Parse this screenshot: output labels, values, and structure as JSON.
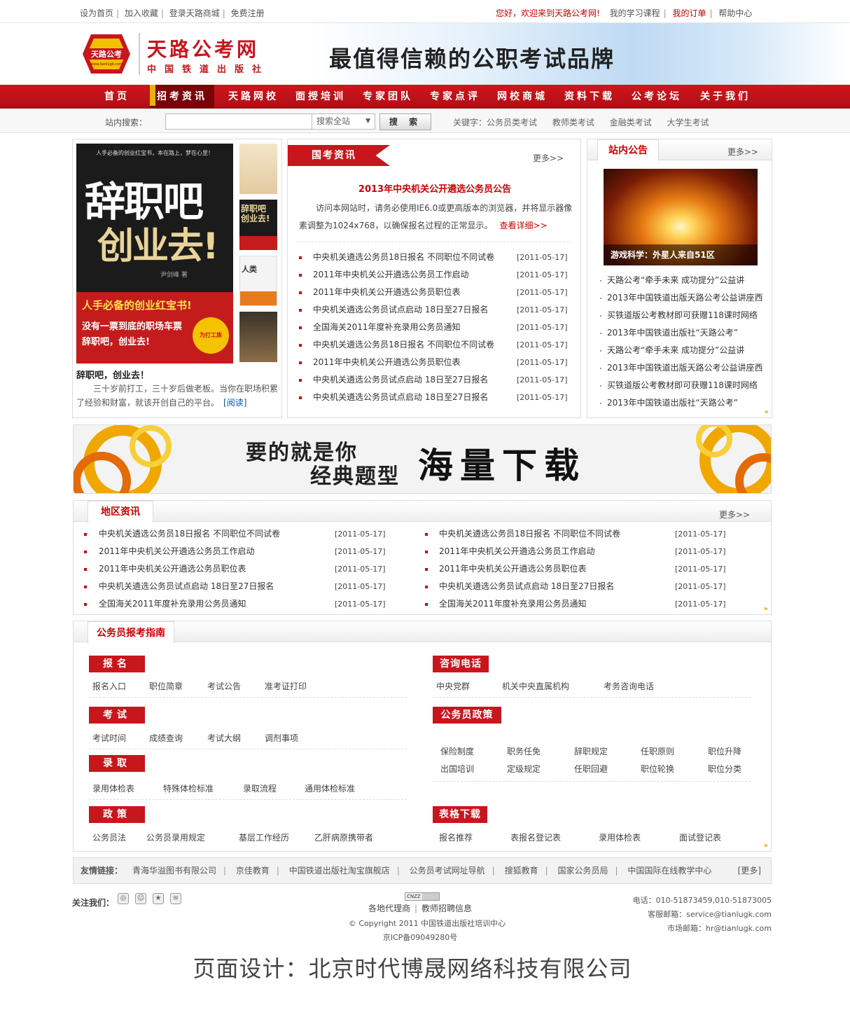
{
  "topbar": {
    "left_links": [
      "设为首页",
      "加入收藏",
      "登录天路商城",
      "免费注册"
    ],
    "welcome": "您好，欢迎来到天路公考网!",
    "right_links": [
      "我的学习课程",
      "我的订单",
      "帮助中心"
    ]
  },
  "header": {
    "logo_badge": "天路公考",
    "logo_badge_url": "www.tianlugk.com",
    "logo_title": "天路公考网",
    "logo_subtitle": "中国铁道出版社",
    "slogan": "最值得信赖的公职考试品牌"
  },
  "nav": {
    "items": [
      "首页",
      "招考资讯",
      "天路网校",
      "面授培训",
      "专家团队",
      "专家点评",
      "网校商城",
      "资料下载",
      "公考论坛",
      "关于我们"
    ],
    "active_index": 1
  },
  "search": {
    "label": "站内搜索：",
    "value": "",
    "scope": "搜索全站",
    "button": "搜 索",
    "keywords_label": "关键字：",
    "keywords": [
      "公务员类考试",
      "教师类考试",
      "金融类考试",
      "大学生考试"
    ]
  },
  "book": {
    "cover_tagline": "人手必备的创业红宝书，本在路上，梦在心里！",
    "cover_title_1": "辞职吧",
    "cover_title_2": "创业去!",
    "cover_author": "尹剑峰 著",
    "cover_red_1": "人手必备的创业红宝书!",
    "cover_red_2": "没有一票到底的职场车票",
    "cover_red_3": "辞职吧，创业去!",
    "cover_badge": "为打工族",
    "thumb_title": "辞职吧 创业去!",
    "thumb_title_2": "人类",
    "title": "辞职吧，创业去！",
    "desc": "三十岁前打工，三十岁后做老板。当你在职场积累了经验和财富，就该开创自己的平台。",
    "read": "[阅读]"
  },
  "exam_news": {
    "tab": "国考资讯",
    "more": "更多>>",
    "headline": "2013年中央机关公开遴选公务员公告",
    "summary": "访问本网站时，请务必使用IE6.0或更高版本的浏览器，并将显示器像素调整为1024x768，以确保报名过程的正常显示。",
    "detail": "查看详细>>",
    "items": [
      {
        "title": "中央机关遴选公务员18日报名 不同职位不同试卷",
        "date": "[2011-05-17]"
      },
      {
        "title": "2011年中央机关公开遴选公务员工作启动",
        "date": "[2011-05-17]"
      },
      {
        "title": "2011年中央机关公开遴选公务员职位表",
        "date": "[2011-05-17]"
      },
      {
        "title": "中央机关遴选公务员试点启动 18日至27日报名",
        "date": "[2011-05-17]"
      },
      {
        "title": "全国海关2011年度补充录用公务员通知",
        "date": "[2011-05-17]"
      },
      {
        "title": "中央机关遴选公务员18日报名 不同职位不同试卷",
        "date": "[2011-05-17]"
      },
      {
        "title": "2011年中央机关公开遴选公务员职位表",
        "date": "[2011-05-17]"
      },
      {
        "title": "中央机关遴选公务员试点启动 18日至27日报名",
        "date": "[2011-05-17]"
      },
      {
        "title": "中央机关遴选公务员试点启动 18日至27日报名",
        "date": "[2011-05-17]"
      }
    ]
  },
  "notice": {
    "tab": "站内公告",
    "more": "更多>>",
    "image_caption": "游戏科学：外星人来自51区",
    "items": [
      "天路公考“牵手未来 成功提分”公益讲",
      "2013年中国铁道出版天路公考公益讲座西",
      "买铁道版公考教材即可获赠118课时网络",
      "2013年中国铁道出版社“天路公考”",
      "天路公考“牵手未来 成功提分”公益讲",
      "2013年中国铁道出版天路公考公益讲座西",
      "买铁道版公考教材即可获赠118课时网络",
      "2013年中国铁道出版社“天路公考”"
    ]
  },
  "ad_banner": {
    "line1": "要的就是你",
    "line2": "经典题型",
    "big": "海量下载"
  },
  "regional": {
    "tab": "地区资讯",
    "more": "更多>>",
    "left": [
      {
        "title": "中央机关遴选公务员18日报名 不同职位不同试卷",
        "date": "[2011-05-17]"
      },
      {
        "title": "2011年中央机关公开遴选公务员工作启动",
        "date": "[2011-05-17]"
      },
      {
        "title": "2011年中央机关公开遴选公务员职位表",
        "date": "[2011-05-17]"
      },
      {
        "title": "中央机关遴选公务员试点启动 18日至27日报名",
        "date": "[2011-05-17]"
      },
      {
        "title": "全国海关2011年度补充录用公务员通知",
        "date": "[2011-05-17]"
      }
    ],
    "right": [
      {
        "title": "中央机关遴选公务员18日报名 不同职位不同试卷",
        "date": "[2011-05-17]"
      },
      {
        "title": "2011年中央机关公开遴选公务员工作启动",
        "date": "[2011-05-17]"
      },
      {
        "title": "2011年中央机关公开遴选公务员职位表",
        "date": "[2011-05-17]"
      },
      {
        "title": "中央机关遴选公务员试点启动 18日至27日报名",
        "date": "[2011-05-17]"
      },
      {
        "title": "全国海关2011年度补充录用公务员通知",
        "date": "[2011-05-17]"
      }
    ]
  },
  "guide": {
    "tab": "公务员报考指南",
    "signup": {
      "title": "报名",
      "links": [
        "报名入口",
        "职位简章",
        "考试公告",
        "准考证打印"
      ]
    },
    "exam": {
      "title": "考试",
      "links": [
        "考试时间",
        "成绩查询",
        "考试大纲",
        "调剂事项"
      ]
    },
    "admit": {
      "title": "录取",
      "links": [
        "录用体检表",
        "特殊体检标准",
        "录取流程",
        "通用体检标准"
      ]
    },
    "policy": {
      "title": "政策",
      "links": [
        "公务员法",
        "公务员录用规定",
        "基层工作经历",
        "乙肝病原携带者"
      ]
    },
    "phone": {
      "title": "咨询电话",
      "links": [
        "中央党群",
        "机关中央直属机构",
        "考务咨询电话"
      ]
    },
    "civil_policy": {
      "title": "公务员政策",
      "links": [
        "保险制度",
        "职务任免",
        "辞职规定",
        "任职原则",
        "职位升降",
        "出国培训",
        "定级规定",
        "任职回避",
        "职位轮换",
        "职位分类"
      ]
    },
    "forms": {
      "title": "表格下载",
      "links": [
        "报名推荐",
        "表报名登记表",
        "录用体检表",
        "面试登记表"
      ]
    }
  },
  "friends": {
    "label": "友情链接：",
    "links": [
      "青海华溢图书有限公司",
      "京佳教育",
      "中国铁道出版社淘宝旗舰店",
      "公务员考试网址导航",
      "搜狐教育",
      "国家公务员局",
      "中国国际在线教学中心"
    ],
    "more": "[更多]"
  },
  "footer": {
    "follow": "关注我们：",
    "cnzz": "CNZZ",
    "center_links": [
      "各地代理商",
      "教师招聘信息"
    ],
    "copyright": "© Copyright 2011 中国铁道出版社培训中心",
    "icp": "京ICP备09049280号",
    "phone": "电话：010-51873459,010-51873005",
    "service_mail": "客服邮箱：service@tianlugk.com",
    "market_mail": "市场邮箱：hr@tianlugk.com"
  },
  "credit": "页面设计：北京时代博晟网络科技有限公司",
  "colors": {
    "brand_red": "#c8161d",
    "nav_dark": "#7a0308",
    "accent_gold": "#e8a000"
  }
}
